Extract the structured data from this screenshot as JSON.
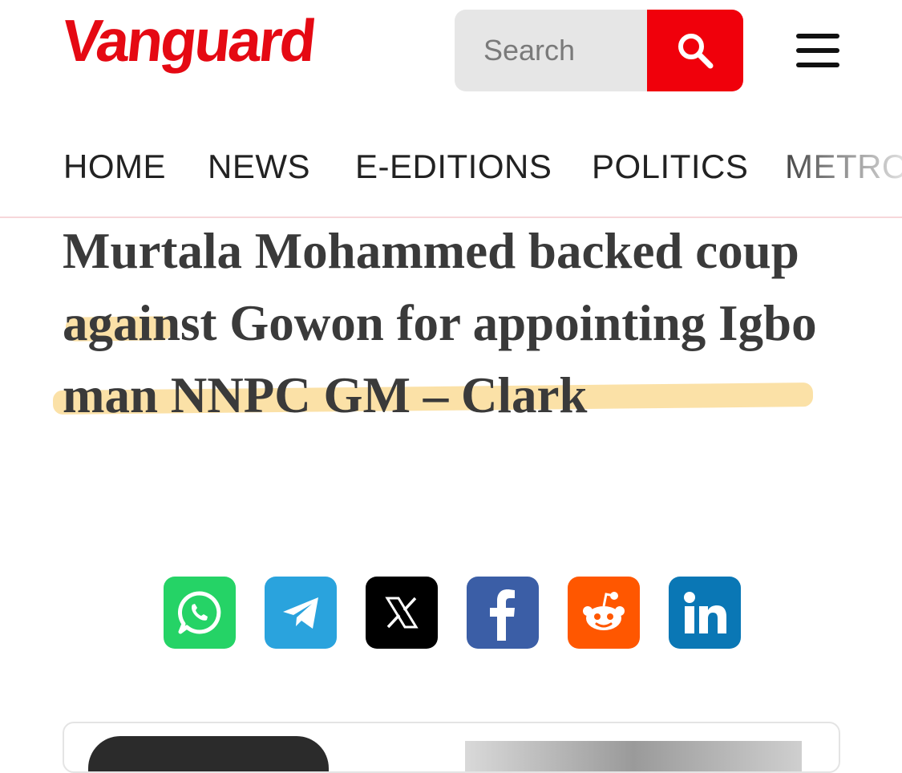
{
  "header": {
    "logo": "Vanguard",
    "search": {
      "placeholder": "Search",
      "button_icon": "search-icon"
    },
    "menu_icon": "hamburger-menu-icon"
  },
  "nav": {
    "items": [
      {
        "label": "HOME"
      },
      {
        "label": "NEWS"
      },
      {
        "label": "E-EDITIONS"
      },
      {
        "label": "POLITICS"
      },
      {
        "label": "METRO"
      }
    ]
  },
  "article": {
    "title": "Murtala Mohammed backed coup against Gowon for appointing Igbo man NNPC GM – Clark"
  },
  "share": [
    {
      "name": "whatsapp",
      "icon": "whatsapp-icon",
      "color": "#25d366"
    },
    {
      "name": "telegram",
      "icon": "telegram-icon",
      "color": "#2aa3dd"
    },
    {
      "name": "x",
      "icon": "x-icon",
      "color": "#000000"
    },
    {
      "name": "facebook",
      "icon": "facebook-icon",
      "color": "#3b5ea6"
    },
    {
      "name": "reddit",
      "icon": "reddit-icon",
      "color": "#ff5700"
    },
    {
      "name": "linkedin",
      "icon": "linkedin-icon",
      "color": "#0a77b5"
    }
  ],
  "colors": {
    "brand": "#e50913",
    "search_button": "#f0000b",
    "highlight": "#f7c85f"
  }
}
